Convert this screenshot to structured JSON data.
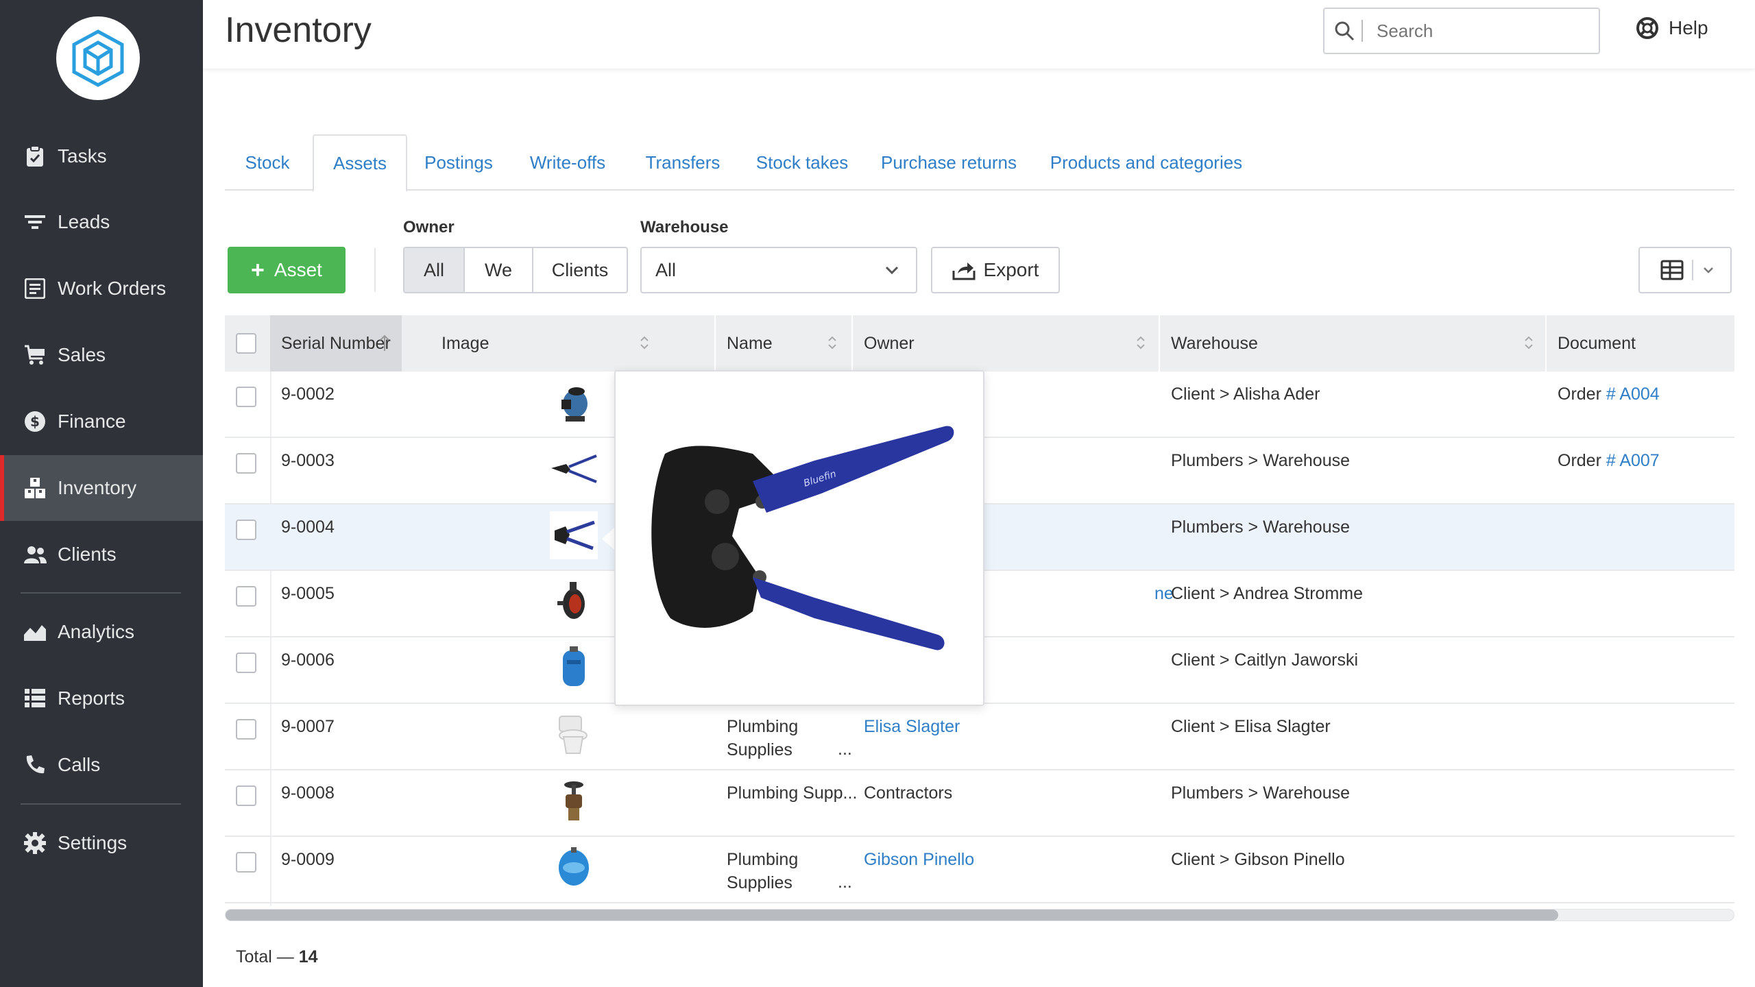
{
  "sidebar": {
    "items": [
      {
        "label": "Tasks",
        "icon": "clipboard-icon"
      },
      {
        "label": "Leads",
        "icon": "filter-icon"
      },
      {
        "label": "Work Orders",
        "icon": "document-icon"
      },
      {
        "label": "Sales",
        "icon": "cart-icon"
      },
      {
        "label": "Finance",
        "icon": "dollar-icon"
      },
      {
        "label": "Inventory",
        "icon": "boxes-icon"
      },
      {
        "label": "Clients",
        "icon": "users-icon"
      },
      {
        "label": "Analytics",
        "icon": "chart-icon"
      },
      {
        "label": "Reports",
        "icon": "list-icon"
      },
      {
        "label": "Calls",
        "icon": "phone-icon"
      },
      {
        "label": "Settings",
        "icon": "gear-icon"
      }
    ],
    "active": "Inventory"
  },
  "header": {
    "title": "Inventory",
    "search_placeholder": "Search",
    "help_label": "Help"
  },
  "tabs": [
    {
      "label": "Stock"
    },
    {
      "label": "Assets",
      "active": true
    },
    {
      "label": "Postings"
    },
    {
      "label": "Write-offs"
    },
    {
      "label": "Transfers"
    },
    {
      "label": "Stock takes"
    },
    {
      "label": "Purchase returns"
    },
    {
      "label": "Products and categories"
    }
  ],
  "toolbar": {
    "add_label": "Asset",
    "owner_label": "Owner",
    "owner_options": [
      "All",
      "We",
      "Clients"
    ],
    "owner_selected": "All",
    "warehouse_label": "Warehouse",
    "warehouse_value": "All",
    "export_label": "Export"
  },
  "table": {
    "columns": [
      "Serial Number",
      "Image",
      "Name",
      "Owner",
      "Warehouse",
      "Document"
    ],
    "rows": [
      {
        "serial": "9-0002",
        "name": "",
        "owner": "",
        "warehouse": "Client > Alisha Ader",
        "doc_prefix": "Order",
        "doc_link": "# A004"
      },
      {
        "serial": "9-0003",
        "name": "",
        "owner": "",
        "warehouse": "Plumbers > Warehouse",
        "doc_prefix": "Order",
        "doc_link": "# A007"
      },
      {
        "serial": "9-0004",
        "name": "",
        "owner": "",
        "warehouse": "Plumbers > Warehouse",
        "doc_prefix": "",
        "doc_link": ""
      },
      {
        "serial": "9-0005",
        "name": "",
        "owner": "ne",
        "warehouse": "Client > Andrea Stromme",
        "doc_prefix": "",
        "doc_link": ""
      },
      {
        "serial": "9-0006",
        "name": "",
        "owner": "",
        "warehouse": "Client > Caitlyn Jaworski",
        "doc_prefix": "",
        "doc_link": ""
      },
      {
        "serial": "9-0007",
        "name": "Plumbing Supplies",
        "owner": "Elisa Slagter",
        "warehouse": "Client > Elisa Slagter",
        "doc_prefix": "",
        "doc_link": ""
      },
      {
        "serial": "9-0008",
        "name": "Plumbing Supp...",
        "owner": "Contractors",
        "warehouse": "Plumbers > Warehouse",
        "doc_prefix": "",
        "doc_link": ""
      },
      {
        "serial": "9-0009",
        "name": "Plumbing Supplies",
        "owner": "Gibson Pinello",
        "warehouse": "Client > Gibson Pinello",
        "doc_prefix": "",
        "doc_link": ""
      }
    ],
    "ellipsis": "...",
    "popup_brand": "Bluefin"
  },
  "footer": {
    "total_label": "Total —",
    "total_value": "14"
  },
  "colors": {
    "accent": "#2f7fc8",
    "add_button": "#4cb654",
    "sidebar": "#2f3339",
    "active_marker": "#e02a2a"
  }
}
